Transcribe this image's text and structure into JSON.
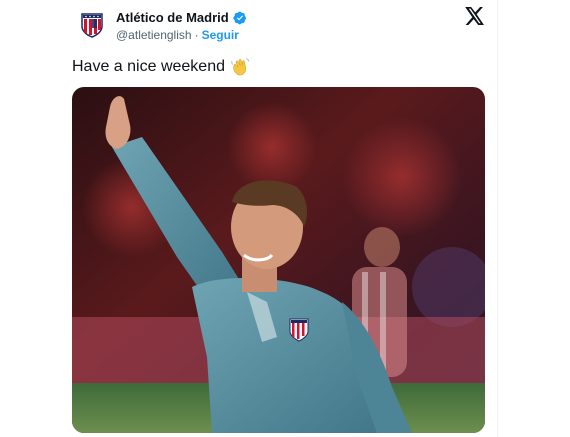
{
  "tweet": {
    "author_name": "Atlético de Madrid",
    "handle": "@atletienglish",
    "separator": "·",
    "follow_label": "Seguir",
    "text": "Have a nice weekend",
    "emoji": "waving-hand-emoji"
  },
  "icons": {
    "verified": "verified-badge-icon",
    "platform": "x-logo-icon",
    "avatar": "club-crest"
  },
  "colors": {
    "follow_link": "#1d9bf0",
    "verified_badge": "#1d9bf0",
    "handle_gray": "#536471"
  }
}
